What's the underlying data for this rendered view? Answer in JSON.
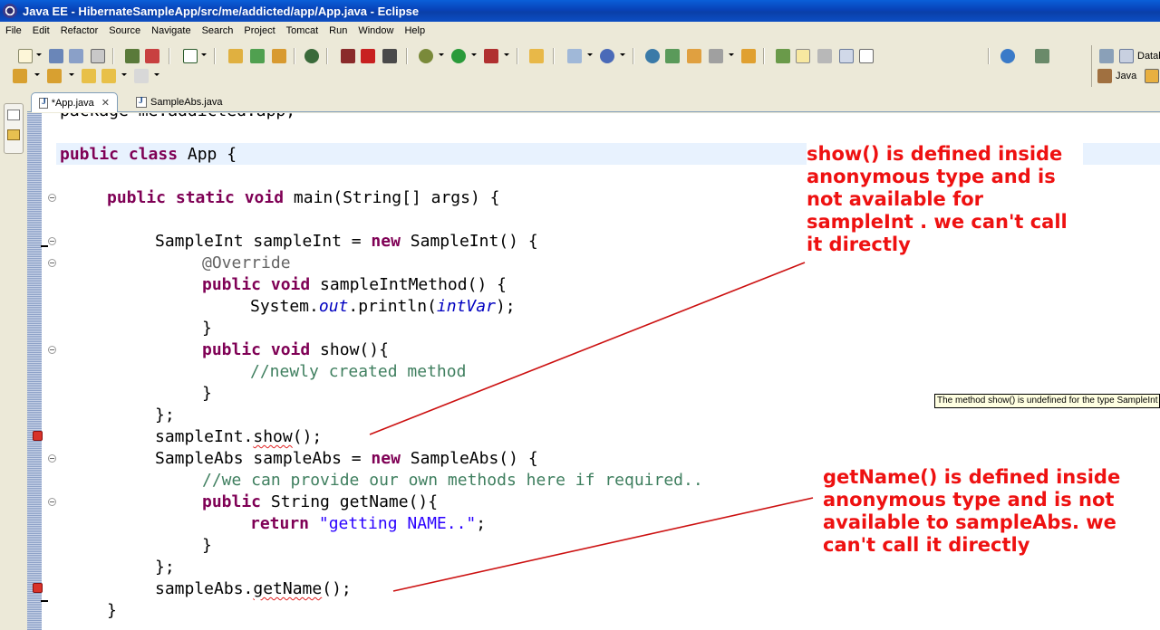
{
  "window": {
    "title": "Java EE - HibernateSampleApp/src/me/addicted/app/App.java - Eclipse"
  },
  "menu": [
    "File",
    "Edit",
    "Refactor",
    "Source",
    "Navigate",
    "Search",
    "Project",
    "Tomcat",
    "Run",
    "Window",
    "Help"
  ],
  "perspectives": {
    "database_label": "Datab",
    "java_label": "Java"
  },
  "tabs": [
    {
      "label": "*App.java",
      "active": true
    },
    {
      "label": "SampleAbs.java",
      "active": false
    }
  ],
  "code": {
    "l0": "package me.addicted.app;",
    "l1_kw": "public class",
    "l1_rest": " App {",
    "l2_kw": "public static void",
    "l2_rest": " main(String[] args) {",
    "l3_a": "SampleInt sampleInt = ",
    "l3_kw": "new",
    "l3_b": " SampleInt() {",
    "l4": "@Override",
    "l5_kw": "public void",
    "l5_rest": " sampleIntMethod() {",
    "l6_a": "System.",
    "l6_out": "out",
    "l6_b": ".println(",
    "l6_var": "intVar",
    "l6_c": ");",
    "l7": "}",
    "l8_kw": "public void",
    "l8_rest": " show(){",
    "l9": "//newly created method",
    "l10": "}",
    "l11": "};",
    "l12_a": "sampleInt.",
    "l12_err": "show",
    "l12_b": "();",
    "l13_a": "SampleAbs sampleAbs = ",
    "l13_kw": "new",
    "l13_b": " SampleAbs() {",
    "l14": "//we can provide our own methods here if required..",
    "l15_kw": "public",
    "l15_rest": " String getName(){",
    "l16_kw": "return",
    "l16_str": "\"getting NAME..\"",
    "l16_end": ";",
    "l17": "}",
    "l18": "};",
    "l19_a": "sampleAbs.",
    "l19_err": "getName",
    "l19_b": "();",
    "l20": "}"
  },
  "tooltip": "The method show() is undefined for the type SampleInt",
  "notes": {
    "show_note": [
      "show() is defined inside",
      "anonymous type and is",
      "not available for",
      "sampleInt . we can't call",
      "it directly"
    ],
    "getname_note": [
      "getName() is defined inside",
      "anonymous type and is not",
      "available to sampleAbs. we",
      "can't call it directly"
    ]
  },
  "colors": {
    "annotation": "#ee1111",
    "keyword": "#7f0055",
    "comment": "#3f7f5f",
    "string": "#2a00ff"
  }
}
